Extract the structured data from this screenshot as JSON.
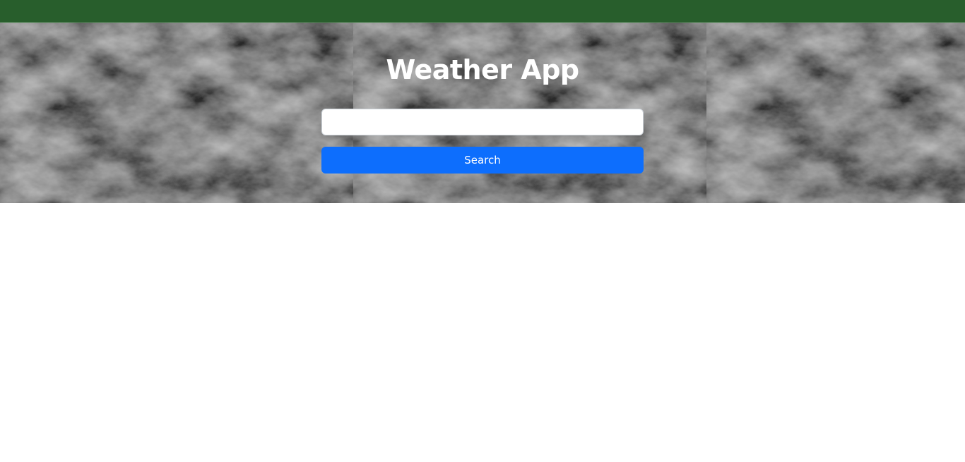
{
  "header": {
    "bar_color": "#285e2c"
  },
  "hero": {
    "title": "Weather App",
    "background": "stormy-clouds-image"
  },
  "search": {
    "value": "",
    "placeholder": "",
    "button_label": "Search",
    "button_color": "#0d6efd"
  }
}
